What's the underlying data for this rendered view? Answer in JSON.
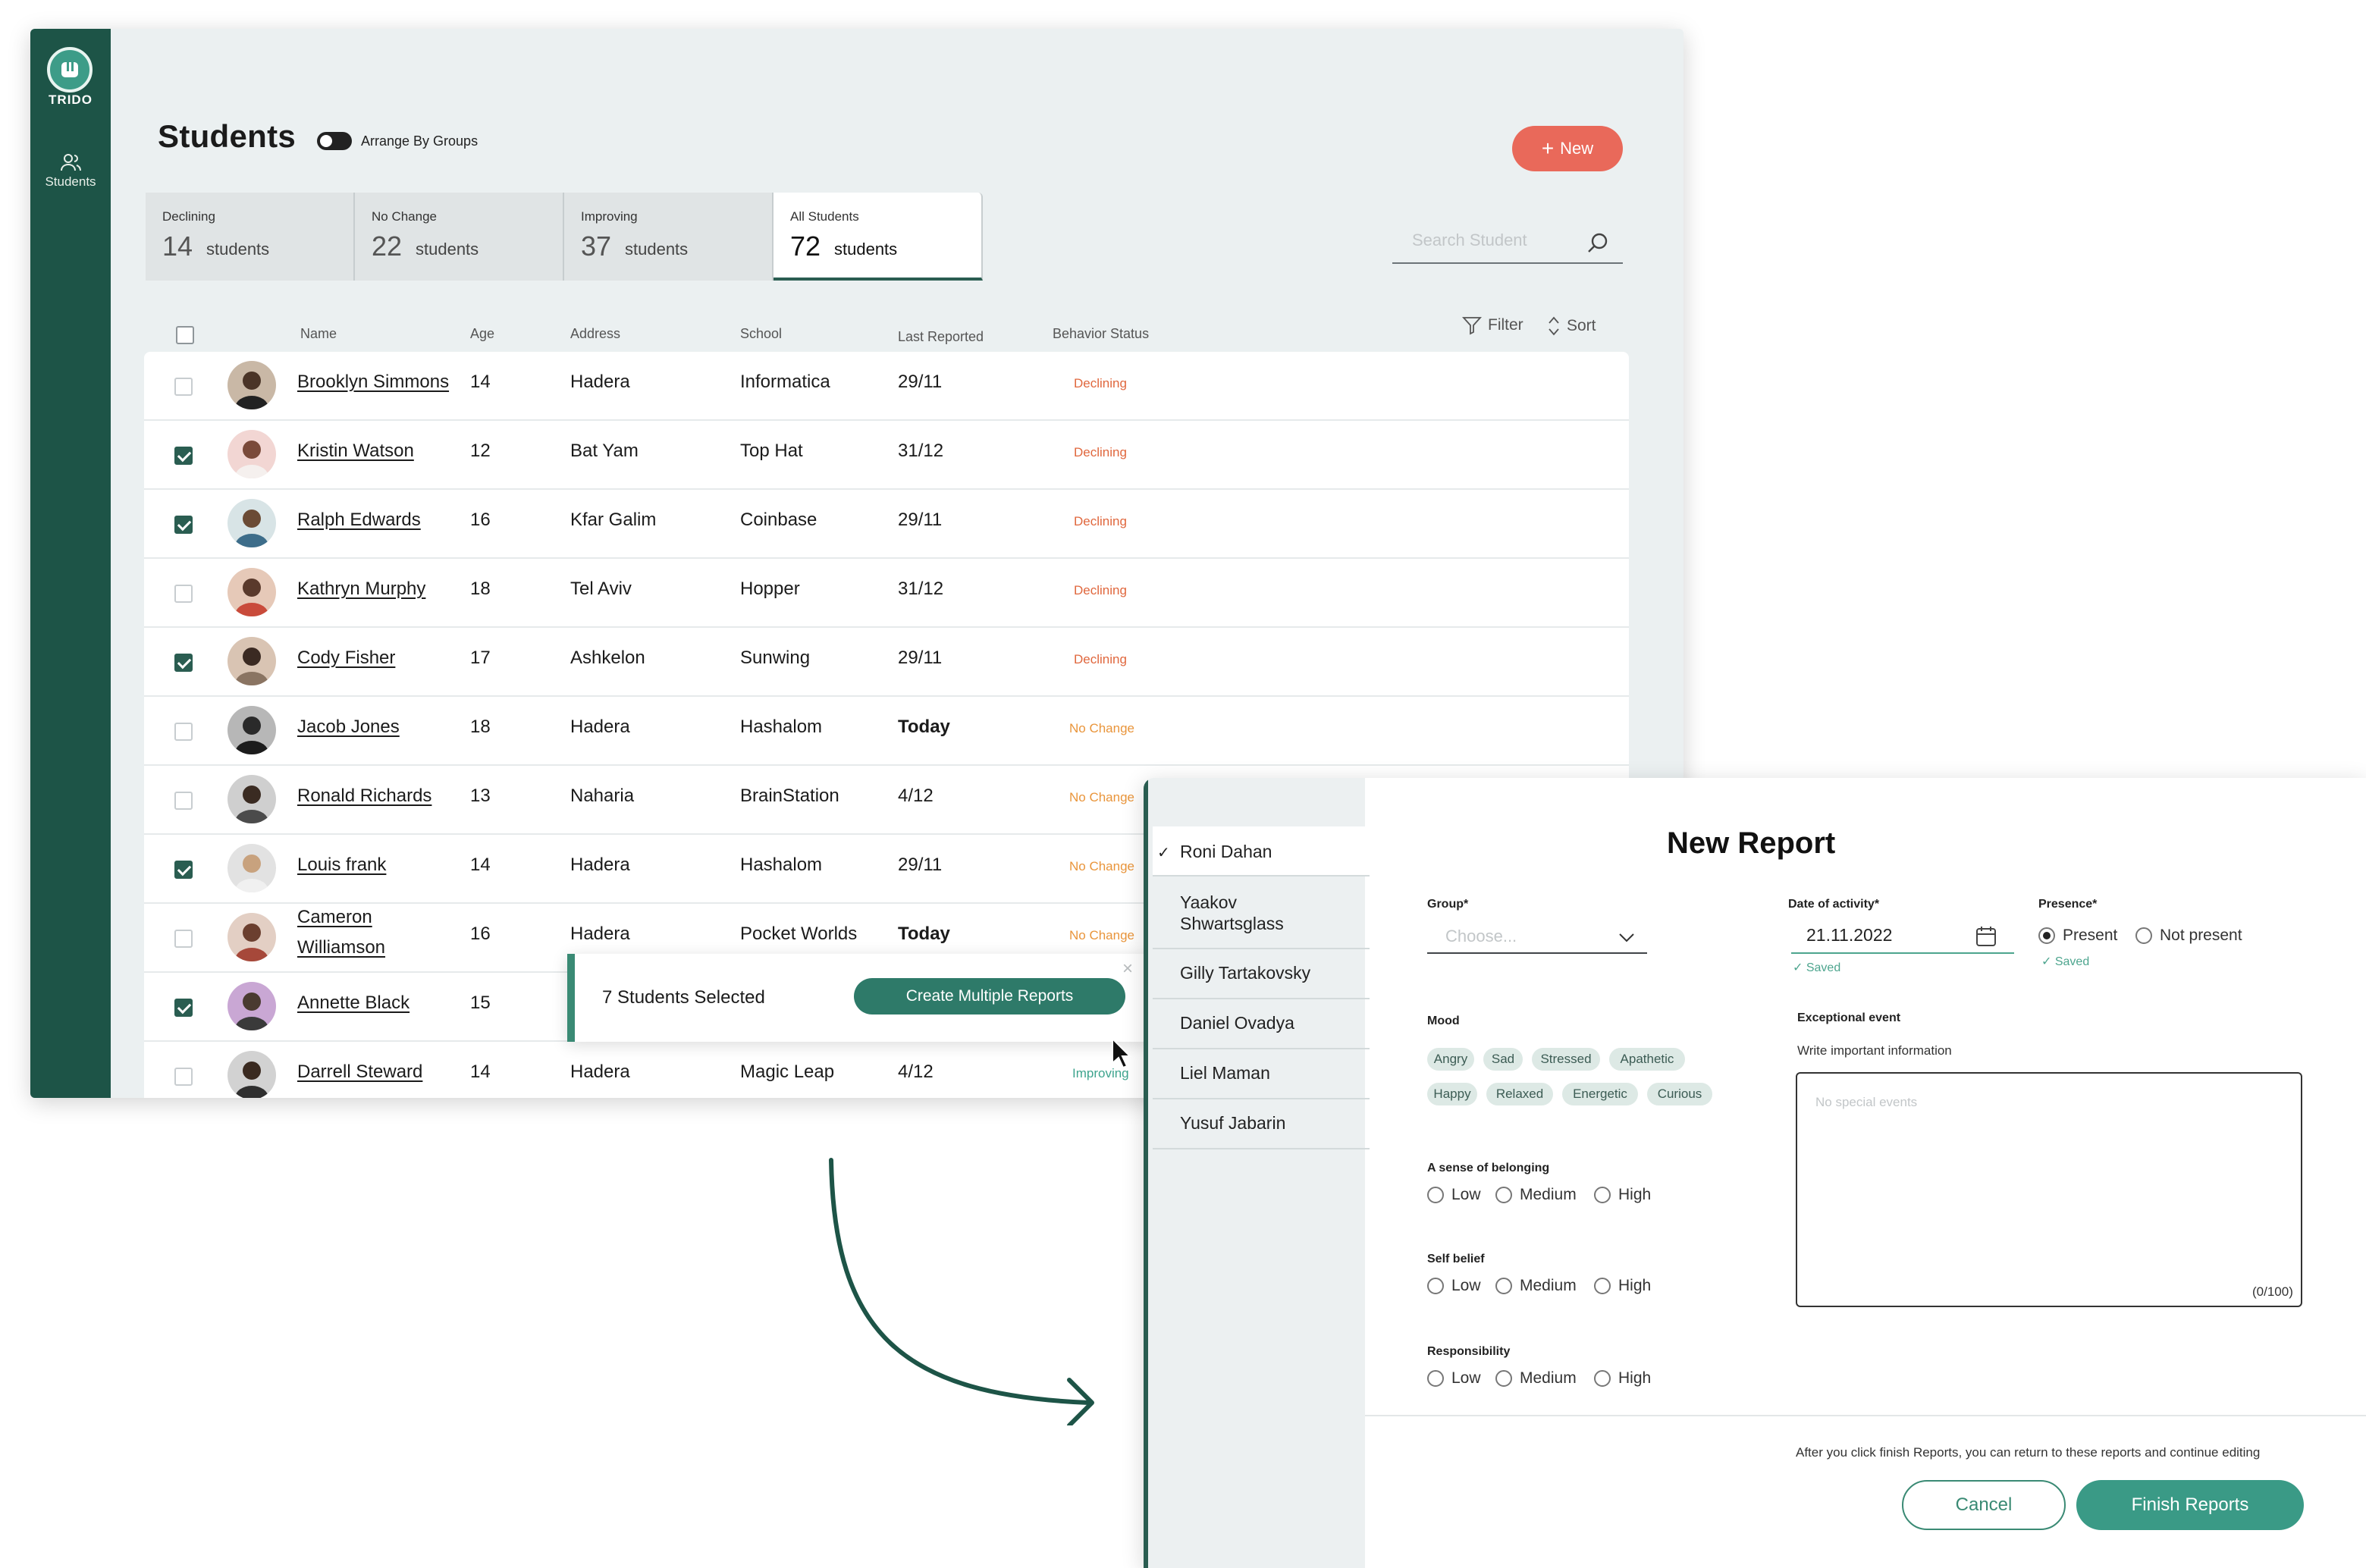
{
  "app": {
    "logo_text": "TRIDO",
    "nav_students": "Students"
  },
  "page": {
    "title": "Students",
    "toggle_label": "Arrange By Groups",
    "new_button": "New",
    "search_placeholder": "Search Student",
    "filter_label": "Filter",
    "sort_label": "Sort"
  },
  "tabs": [
    {
      "label": "Declining",
      "count": "14",
      "unit": "students"
    },
    {
      "label": "No Change",
      "count": "22",
      "unit": "students"
    },
    {
      "label": "Improving",
      "count": "37",
      "unit": "students"
    },
    {
      "label": "All Students",
      "count": "72",
      "unit": "students"
    }
  ],
  "table": {
    "headers": {
      "name": "Name",
      "age": "Age",
      "address": "Address",
      "school": "School",
      "last_reported": "Last Reported",
      "behavior": "Behavior Status"
    },
    "rows": [
      {
        "name": "Brooklyn Simmons",
        "age": "14",
        "address": "Hadera",
        "school": "Informatica",
        "last": "29/11",
        "status": "Declining",
        "checked": false
      },
      {
        "name": "Kristin Watson",
        "age": "12",
        "address": "Bat Yam",
        "school": "Top Hat",
        "last": "31/12",
        "status": "Declining",
        "checked": true
      },
      {
        "name": "Ralph Edwards",
        "age": "16",
        "address": "Kfar Galim",
        "school": "Coinbase",
        "last": "29/11",
        "status": "Declining",
        "checked": true
      },
      {
        "name": "Kathryn Murphy",
        "age": "18",
        "address": "Tel Aviv",
        "school": "Hopper",
        "last": "31/12",
        "status": "Declining",
        "checked": false
      },
      {
        "name": "Cody Fisher",
        "age": "17",
        "address": "Ashkelon",
        "school": "Sunwing",
        "last": "29/11",
        "status": "Declining",
        "checked": true
      },
      {
        "name": "Jacob Jones",
        "age": "18",
        "address": "Hadera",
        "school": "Hashalom",
        "last": "Today",
        "status": "No Change",
        "checked": false
      },
      {
        "name": "Ronald Richards",
        "age": "13",
        "address": "Naharia",
        "school": "BrainStation",
        "last": "4/12",
        "status": "No Change",
        "checked": false
      },
      {
        "name": "Louis frank",
        "age": "14",
        "address": "Hadera",
        "school": "Hashalom",
        "last": "29/11",
        "status": "No Change",
        "checked": true
      },
      {
        "name_line1": "Cameron",
        "name_line2": "Williamson",
        "age": "16",
        "address": "Hadera",
        "school": "Pocket Worlds",
        "last": "Today",
        "status": "No Change",
        "checked": false
      },
      {
        "name": "Annette Black",
        "age": "15",
        "checked": true
      },
      {
        "name": "Darrell Steward",
        "age": "14",
        "address": "Hadera",
        "school": "Magic Leap",
        "last": "4/12",
        "status": "Improving",
        "checked": false
      }
    ]
  },
  "selection": {
    "text": "7 Students Selected",
    "button": "Create Multiple Reports"
  },
  "report": {
    "title": "New Report",
    "students": [
      "Roni Dahan",
      "Yaakov Shwartsglass",
      "Gilly Tartakovsky",
      "Daniel Ovadya",
      "Liel Maman",
      "Yusuf Jabarin"
    ],
    "group_label": "Group*",
    "group_placeholder": "Choose...",
    "date_label": "Date of activity*",
    "date_value": "21.11.2022",
    "saved": "Saved",
    "presence_label": "Presence*",
    "present": "Present",
    "not_present": "Not present",
    "mood_label": "Mood",
    "moods": [
      "Angry",
      "Sad",
      "Stressed",
      "Apathetic",
      "Happy",
      "Relaxed",
      "Energetic",
      "Curious"
    ],
    "exceptional_label": "Exceptional event",
    "exceptional_hint": "Write important information",
    "exceptional_placeholder": "No special events",
    "char_count": "(0/100)",
    "belonging_label": "A sense of belonging",
    "self_belief_label": "Self belief",
    "responsibility_label": "Responsibility",
    "scale": [
      "Low",
      "Medium",
      "High"
    ],
    "footer_note": "After you click finish Reports, you can return to these reports and continue editing",
    "cancel": "Cancel",
    "finish": "Finish Reports"
  },
  "colors": {
    "brand": "#1d5447",
    "accent": "#e9695a",
    "declining": "#e0673d",
    "no_change": "#e9953b",
    "improving": "#3ea48e"
  }
}
